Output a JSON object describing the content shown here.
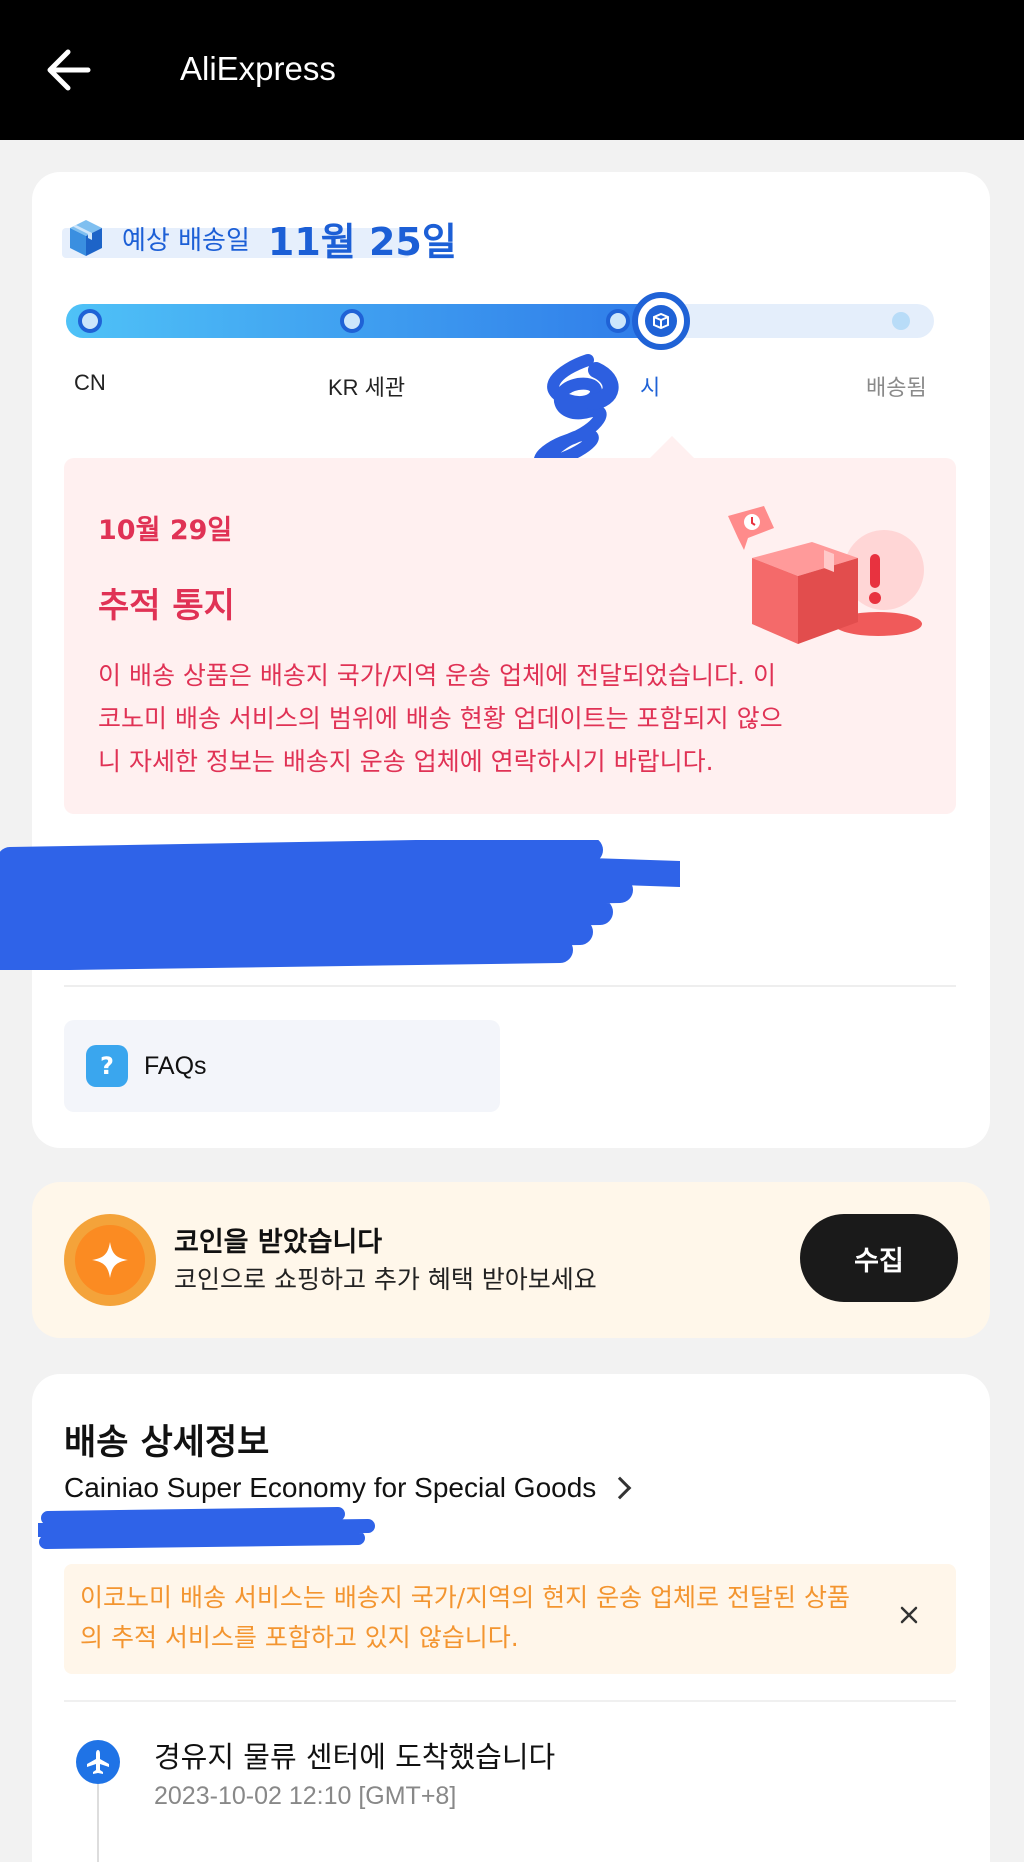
{
  "header": {
    "title": "AliExpress",
    "back_icon": "arrow-left-icon"
  },
  "delivery": {
    "eta_label": "예상 배송일",
    "eta_date": "11월 25일",
    "progress": {
      "steps": [
        {
          "label": "CN",
          "state": "done"
        },
        {
          "label": "KR 세관",
          "state": "done"
        },
        {
          "label": "시",
          "state": "current"
        },
        {
          "label": "배송됨",
          "state": "pending"
        }
      ]
    },
    "notice": {
      "date": "10월 29일",
      "title": "추적 통지",
      "body": "이 배송 상품은 배송지 국가/지역 운송 업체에 전달되었습니다. 이코노미 배송 서비스의 범위에 배송 현황 업데이트는 포함되지 않으니 자세한 정보는 배송지 운송 업체에 연락하시기 바랍니다."
    },
    "faq_label": "FAQs"
  },
  "coins": {
    "title": "코인을 받았습니다",
    "subtitle": "코인으로 쇼핑하고 추가 혜택 받아보세요",
    "button": "수집"
  },
  "shipping_details": {
    "title": "배송 상세정보",
    "carrier": "Cainiao Super Economy for Special Goods",
    "warning": "이코노미 배송 서비스는 배송지 국가/지역의 현지 운송 업체로 전달된 상품의 추적 서비스를 포함하고 있지 않습니다.",
    "events": [
      {
        "title": "경유지 물류 센터에 도착했습니다",
        "time": "2023-10-02 12:10 [GMT+8]",
        "icon": "airplane-icon"
      }
    ]
  },
  "colors": {
    "accent_blue": "#1f62d6",
    "alert_red": "#e03255",
    "warning_orange": "#f39530",
    "coin_orange": "#fb8b22"
  }
}
